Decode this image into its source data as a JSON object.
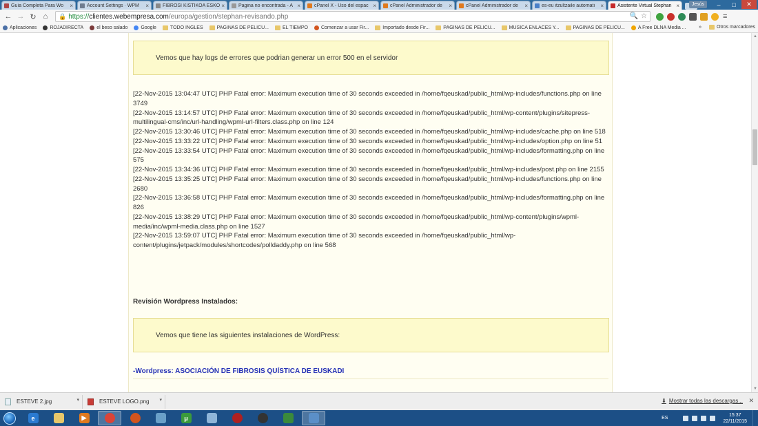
{
  "browser": {
    "tabs": [
      {
        "label": "Guía Completa Para Wo",
        "favicon_color": "#b04646",
        "active": false
      },
      {
        "label": "Account Settings · WPM",
        "favicon_color": "#6f7c8f",
        "active": false
      },
      {
        "label": "FIBROSI KISTIKOA ESKO",
        "favicon_color": "#888888",
        "active": false
      },
      {
        "label": "Pagina no encontrada - A",
        "favicon_color": "#999999",
        "active": false
      },
      {
        "label": "cPanel X - Uso del espac",
        "favicon_color": "#e07a1f",
        "active": false
      },
      {
        "label": "cPanel Administrador de",
        "favicon_color": "#e07a1f",
        "active": false
      },
      {
        "label": "cPanel Administrador de",
        "favicon_color": "#e07a1f",
        "active": false
      },
      {
        "label": "es-eu itzultzaile automati",
        "favicon_color": "#4a80c8",
        "active": false
      },
      {
        "label": "Asistente Virtual Stephan",
        "favicon_color": "#c62b2b",
        "active": true
      }
    ],
    "user_label": "Jesús",
    "url": {
      "scheme": "https://",
      "host": "clientes.webempresa.com",
      "path": "/europa/gestion/stephan-revisando.php"
    },
    "bookmarks": [
      {
        "label": "Aplicaciones",
        "icon": "apps-icon",
        "color": "#4a6fa5"
      },
      {
        "label": "ROJADIRECTA",
        "icon": "site-icon",
        "color": "#333333"
      },
      {
        "label": "el beso salado",
        "icon": "site-icon",
        "color": "#7a3a3a"
      },
      {
        "label": "Google",
        "icon": "google-icon",
        "color": "#4285f4"
      },
      {
        "label": "TODO INGLES",
        "icon": "folder-icon",
        "color": "#e8c76a"
      },
      {
        "label": "PAGINAS DE PELICU...",
        "icon": "folder-icon",
        "color": "#e8c76a"
      },
      {
        "label": "EL TIEMPO",
        "icon": "folder-icon",
        "color": "#e8c76a"
      },
      {
        "label": "Comenzar a usar Fir...",
        "icon": "firefox-icon",
        "color": "#d2541e"
      },
      {
        "label": "Importado desde Fir...",
        "icon": "folder-icon",
        "color": "#e8c76a"
      },
      {
        "label": "PAGINAS DE PELICU...",
        "icon": "folder-icon",
        "color": "#e8c76a"
      },
      {
        "label": "MUSICA ENLACES Y...",
        "icon": "folder-icon",
        "color": "#e8c76a"
      },
      {
        "label": "PAGINAS DE PELICU...",
        "icon": "folder-icon",
        "color": "#e8c76a"
      },
      {
        "label": "A Free DLNA Media ...",
        "icon": "dlna-icon",
        "color": "#f0a500"
      }
    ],
    "other_bookmarks": "Otros marcadores"
  },
  "page": {
    "alert_errors": "Vemos que hay logs de errores que podrian generar un error 500 en el servidor",
    "log_lines": [
      "[22-Nov-2015 13:04:47 UTC] PHP Fatal error: Maximum execution time of 30 seconds exceeded in /home/fqeuskad/public_html/wp-includes/functions.php on line 3749",
      "[22-Nov-2015 13:14:57 UTC] PHP Fatal error: Maximum execution time of 30 seconds exceeded in /home/fqeuskad/public_html/wp-content/plugins/sitepress-multilingual-cms/inc/url-handling/wpml-url-filters.class.php on line 124",
      "[22-Nov-2015 13:30:46 UTC] PHP Fatal error: Maximum execution time of 30 seconds exceeded in /home/fqeuskad/public_html/wp-includes/cache.php on line 518",
      "[22-Nov-2015 13:33:22 UTC] PHP Fatal error: Maximum execution time of 30 seconds exceeded in /home/fqeuskad/public_html/wp-includes/option.php on line 51",
      "[22-Nov-2015 13:33:54 UTC] PHP Fatal error: Maximum execution time of 30 seconds exceeded in /home/fqeuskad/public_html/wp-includes/formatting.php on line 575",
      "[22-Nov-2015 13:34:36 UTC] PHP Fatal error: Maximum execution time of 30 seconds exceeded in /home/fqeuskad/public_html/wp-includes/post.php on line 2155",
      "[22-Nov-2015 13:35:25 UTC] PHP Fatal error: Maximum execution time of 30 seconds exceeded in /home/fqeuskad/public_html/wp-includes/functions.php on line 2680",
      "[22-Nov-2015 13:36:58 UTC] PHP Fatal error: Maximum execution time of 30 seconds exceeded in /home/fqeuskad/public_html/wp-includes/formatting.php on line 826",
      "[22-Nov-2015 13:38:29 UTC] PHP Fatal error: Maximum execution time of 30 seconds exceeded in /home/fqeuskad/public_html/wp-content/plugins/wpml-media/inc/wpml-media.class.php on line 1527",
      "[22-Nov-2015 13:59:07 UTC] PHP Fatal error: Maximum execution time of 30 seconds exceeded in /home/fqeuskad/public_html/wp-content/plugins/jetpack/modules/shortcodes/polldaddy.php on line 568"
    ],
    "section_title": "Revisión Wordpress Instalados:",
    "alert_installs": "Vemos que tiene las siguientes instalaciones de WordPress:",
    "wordpress_link": "-Wordpress: ASOCIACIÓN DE FIBROSIS QUÍSTICA DE EUSKADI"
  },
  "downloads": {
    "items": [
      {
        "label": "ESTEVE 2.jpg",
        "type": "jpg"
      },
      {
        "label": "ESTEVE LOGO.png",
        "type": "png"
      }
    ],
    "show_all": "Mostrar todas las descargas..."
  },
  "taskbar": {
    "apps": [
      {
        "icon": "internet-explorer-icon",
        "color": "#2a7ad1",
        "glyph": "e",
        "active": false
      },
      {
        "icon": "file-explorer-icon",
        "color": "#e8c76a",
        "glyph": "",
        "active": false
      },
      {
        "icon": "media-player-icon",
        "color": "#e07a1f",
        "glyph": "▶",
        "active": false
      },
      {
        "icon": "chrome-icon",
        "color": "#db4437",
        "glyph": "",
        "active": true
      },
      {
        "icon": "firefox-icon",
        "color": "#d2541e",
        "glyph": "",
        "active": false
      },
      {
        "icon": "network-icon",
        "color": "#6aa0c8",
        "glyph": "",
        "active": false
      },
      {
        "icon": "utorrent-icon",
        "color": "#3b9a3b",
        "glyph": "μ",
        "active": false
      },
      {
        "icon": "document-icon",
        "color": "#8fb5d8",
        "glyph": "",
        "active": false
      },
      {
        "icon": "spider-icon",
        "color": "#b02020",
        "glyph": "",
        "active": false
      },
      {
        "icon": "ball-icon",
        "color": "#333333",
        "glyph": "",
        "active": false
      },
      {
        "icon": "keyboard-icon",
        "color": "#3b8a3b",
        "glyph": "",
        "active": false
      },
      {
        "icon": "window-icon",
        "color": "#5b8fc8",
        "glyph": "",
        "active": true
      }
    ],
    "language": "ES",
    "time": "15:37",
    "date": "22/11/2015"
  }
}
